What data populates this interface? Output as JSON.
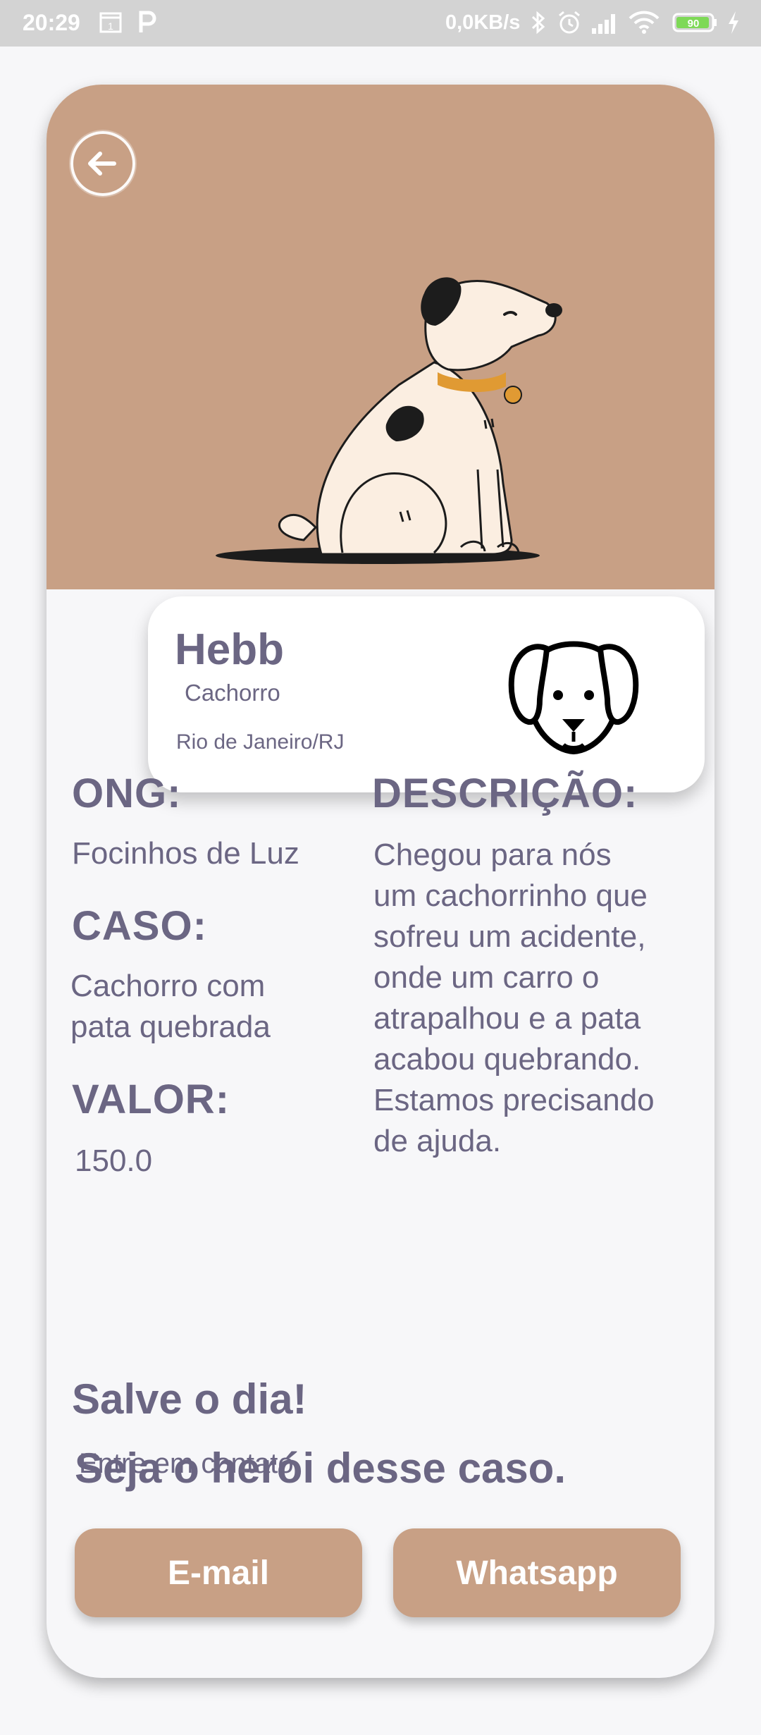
{
  "status_bar": {
    "time": "20:29",
    "net_speed": "0,0KB/s",
    "battery": "90"
  },
  "pet": {
    "name": "Hebb",
    "species": "Cachorro",
    "location": "Rio de Janeiro/RJ"
  },
  "details": {
    "ong_label": "ONG:",
    "ong_value": "Focinhos de Luz",
    "caso_label": "CASO:",
    "caso_value_line1": "Cachorro com",
    "caso_value_line2": "pata quebrada",
    "valor_label": "VALOR:",
    "valor_value": "150.0",
    "descricao_label": "DESCRIÇÃO:",
    "descricao_lines": [
      "Chegou para nós",
      "um cachorrinho que",
      "sofreu um acidente,",
      "onde um carro o",
      "atrapalhou e a pata",
      "acabou quebrando.",
      "Estamos precisando",
      "de ajuda."
    ]
  },
  "cta": {
    "line1": "Salve o dia!",
    "line2": "Seja o herói desse caso.",
    "contact_text": "Entre em contato",
    "email_button": "E-mail",
    "whatsapp_button": "Whatsapp"
  },
  "colors": {
    "accent": "#c8a085",
    "text": "#6b6683",
    "background": "#f7f7f9"
  }
}
